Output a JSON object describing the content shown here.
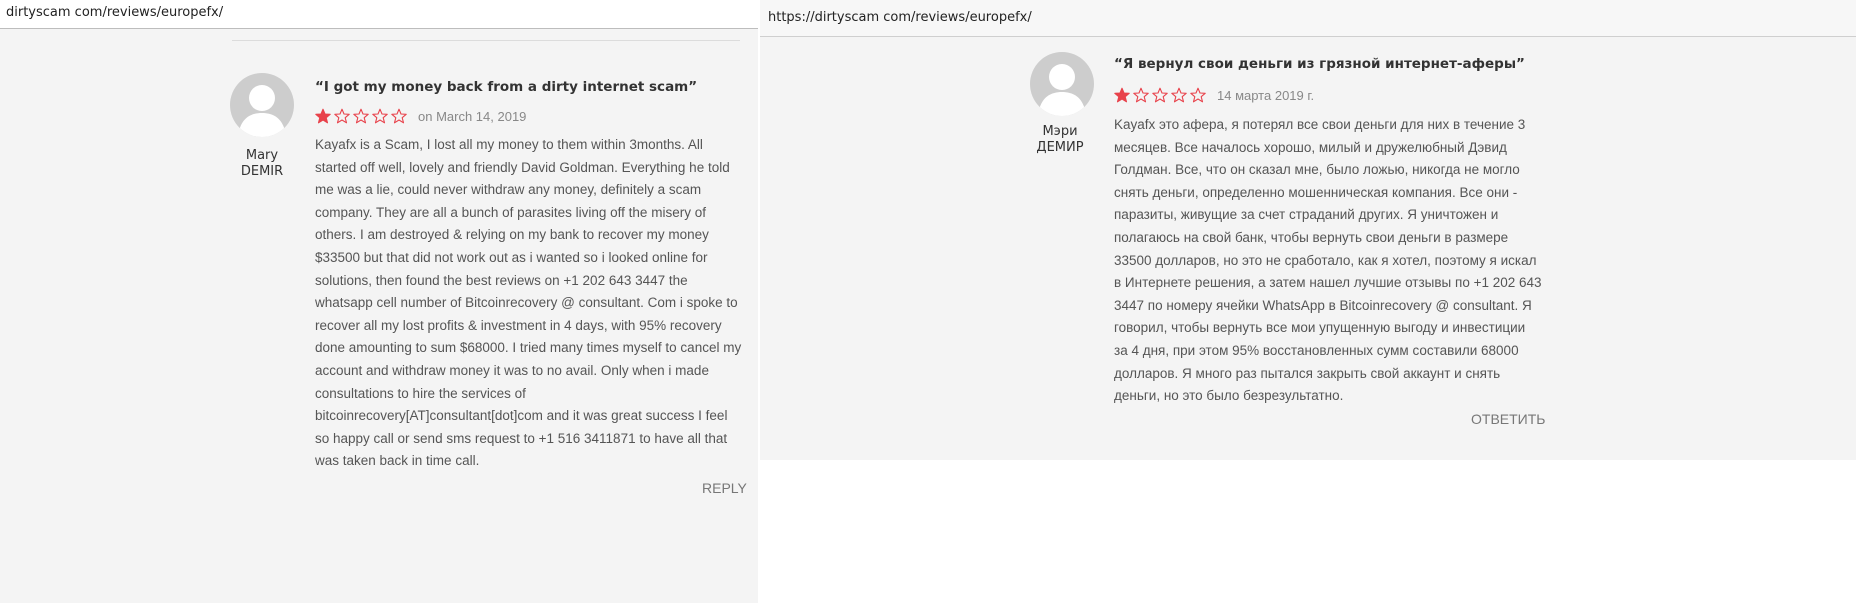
{
  "left": {
    "url": "dirtyscam com/reviews/europefx/",
    "author": {
      "first": "Mary",
      "last": "DEMIR"
    },
    "review_title": "“I got my money back from a dirty internet scam”",
    "rating": {
      "value": 1,
      "max": 5,
      "date": "on March 14, 2019"
    },
    "body": "Kayafx is a Scam, I lost all my money to them within 3months. All started off well, lovely and friendly David Goldman. Everything he told me was a lie, could never withdraw any money, definitely a scam company. They are all a bunch of parasites living off the misery of others. I am destroyed & relying on my bank to recover my money $33500 but that did not work out as i wanted so i looked online for solutions, then found the best reviews on +1 202 643 3447 the whatsapp cell number of Bitcoinrecovery @ consultant. Com i spoke to recover all my lost profits & investment in 4 days, with 95% recovery done amounting to sum $68000. I tried many times myself to cancel my account and withdraw money it was to no avail. Only when i made consultations to hire the services of bitcoinrecovery[AT]consultant[dot]com and it was great success I feel so happy call or send sms request to +1 516 3411871 to have all that was taken back in time call.",
    "reply_label": "REPLY"
  },
  "right": {
    "url": "https://dirtyscam com/reviews/europefx/",
    "author": {
      "first": "Мэри",
      "last": "ДЕМИР"
    },
    "review_title": "“Я вернул свои деньги из грязной интернет-аферы”",
    "rating": {
      "value": 1,
      "max": 5,
      "date": "14 марта 2019 г."
    },
    "body": "Kayafx это афера, я потерял все свои деньги для них в течение 3 месяцев. Все началось хорошо, милый и дружелюбный Дэвид Голдман. Все, что он сказал мне, было ложью, никогда не могло снять деньги, определенно мошенническая компания. Все они - паразиты, живущие за счет страданий других. Я уничтожен и полагаюсь на свой банк, чтобы вернуть свои деньги в размере 33500 долларов, но это не сработало, как я хотел, поэтому я искал в Интернете решения, а затем нашел лучшие отзывы по +1 202 643 3447 по номеру ячейки WhatsApp в Bitcoinrecovery @ consultant. Я говорил, чтобы вернуть все мои упущенную выгоду и инвестиции за 4 дня, при этом 95% восстановленных сумм составили 68000 долларов. Я много раз пытался закрыть свой аккаунт и снять деньги, но это было безрезультатно.",
    "reply_label": "ОТВЕТИТЬ"
  },
  "colors": {
    "star": "#e8424b",
    "panel_bg": "#f4f4f4",
    "avatar": "#cdcdcd"
  }
}
